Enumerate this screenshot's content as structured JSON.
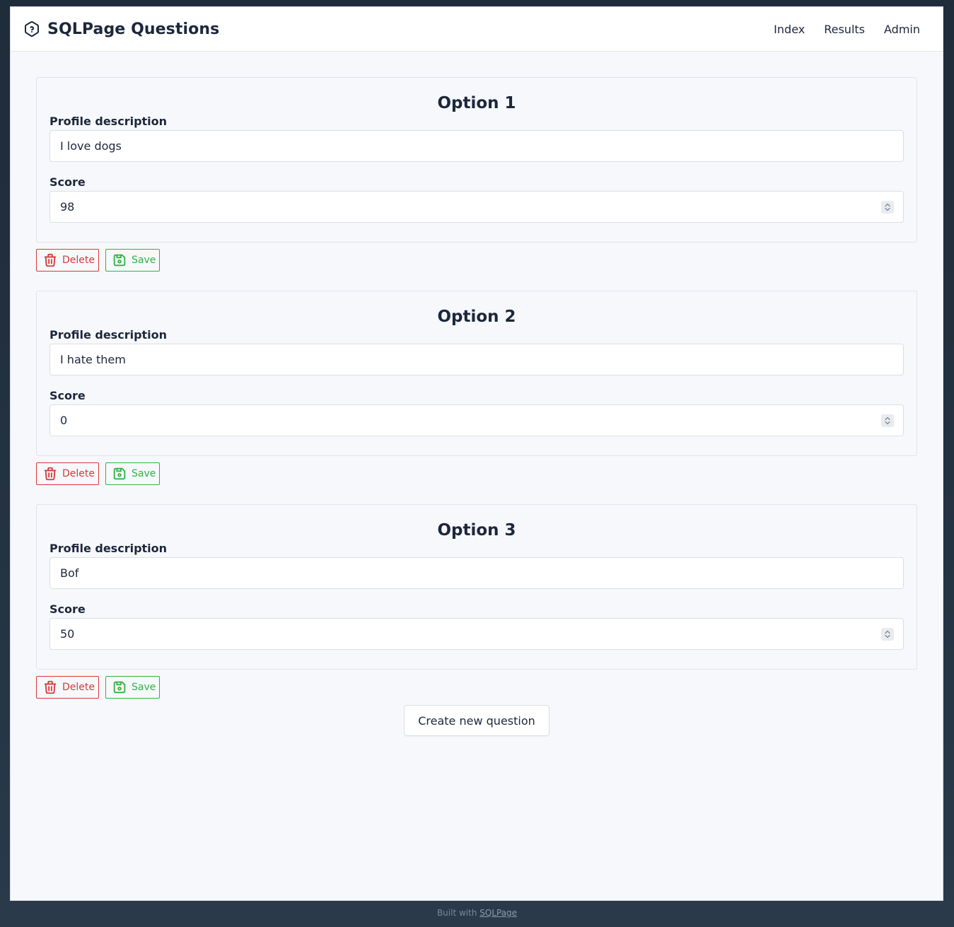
{
  "header": {
    "brand_icon": "hexagon-question-icon",
    "title": "SQLPage Questions",
    "nav": [
      {
        "label": "Index"
      },
      {
        "label": "Results"
      },
      {
        "label": "Admin"
      }
    ]
  },
  "options": [
    {
      "title": "Option 1",
      "description_label": "Profile description",
      "description_value": "I love dogs",
      "score_label": "Score",
      "score_value": "98",
      "delete_label": "Delete",
      "save_label": "Save"
    },
    {
      "title": "Option 2",
      "description_label": "Profile description",
      "description_value": "I hate them",
      "score_label": "Score",
      "score_value": "0",
      "delete_label": "Delete",
      "save_label": "Save"
    },
    {
      "title": "Option 3",
      "description_label": "Profile description",
      "description_value": "Bof",
      "score_label": "Score",
      "score_value": "50",
      "delete_label": "Delete",
      "save_label": "Save"
    }
  ],
  "create_button_label": "Create new question",
  "footer": {
    "prefix": "Built with",
    "link_label": "SQLPage"
  },
  "colors": {
    "danger": "#d63939",
    "success": "#2fb344",
    "text": "#1d273b",
    "background": "#f6f8fb"
  }
}
